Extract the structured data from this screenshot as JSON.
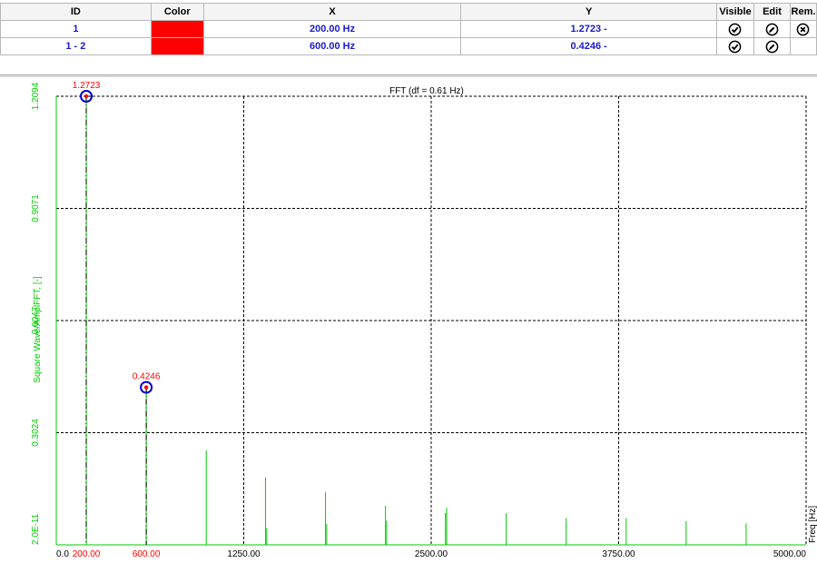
{
  "table": {
    "headers": [
      "ID",
      "Color",
      "X",
      "Y",
      "Visible",
      "Edit",
      "Rem."
    ],
    "rows": [
      {
        "id": "1",
        "color": "#ff0000",
        "x": "200.00 Hz",
        "y": "1.2723 -"
      },
      {
        "id": "1 - 2",
        "color": "#ff0000",
        "x": "600.00 Hz",
        "y": "0.4246 -"
      }
    ]
  },
  "icons": {
    "visible": "check-circle-icon",
    "edit": "pencil-circle-icon",
    "remove": "x-circle-icon"
  },
  "colors": {
    "axis": "#00cc00",
    "series": "#00cc00",
    "cursor": "#ff0000",
    "cursor_ring": "#0000cc",
    "grid": "#000000"
  },
  "chart_data": {
    "type": "line",
    "title": "FFT (df = 0.61 Hz)",
    "ylabel": "Square Wave/AmplFFT, [-]",
    "xlabel": "Freq [Hz]",
    "xlim": [
      0,
      5000
    ],
    "ylim": [
      0,
      1.2094
    ],
    "x_ticks": [
      "0.0",
      "1250.00",
      "2500.00",
      "3750.00",
      "5000.00"
    ],
    "y_ticks": [
      "2.0E-11",
      "0.3024",
      "0.6047",
      "0.9071",
      "1.2094"
    ],
    "grid": true,
    "series": [
      {
        "peaks": [
          {
            "x": 200,
            "y": 1.2723
          },
          {
            "x": 600,
            "y": 0.4246
          },
          {
            "x": 1000,
            "y": 0.2546
          },
          {
            "x": 1395,
            "y": 0.1815
          },
          {
            "x": 1403,
            "y": 0.045
          },
          {
            "x": 1795,
            "y": 0.1415
          },
          {
            "x": 1803,
            "y": 0.056
          },
          {
            "x": 2195,
            "y": 0.105
          },
          {
            "x": 2203,
            "y": 0.065
          },
          {
            "x": 2595,
            "y": 0.086
          },
          {
            "x": 2603,
            "y": 0.1
          },
          {
            "x": 3000,
            "y": 0.085
          },
          {
            "x": 3400,
            "y": 0.072
          },
          {
            "x": 3800,
            "y": 0.072
          },
          {
            "x": 4200,
            "y": 0.064
          },
          {
            "x": 4600,
            "y": 0.058
          }
        ]
      }
    ],
    "cursors": [
      {
        "x": 200,
        "x_label": "200.00",
        "y": 1.2723,
        "value_label": "1.2723"
      },
      {
        "x": 600,
        "x_label": "600.00",
        "y": 0.4246,
        "value_label": "0.4246"
      }
    ]
  }
}
